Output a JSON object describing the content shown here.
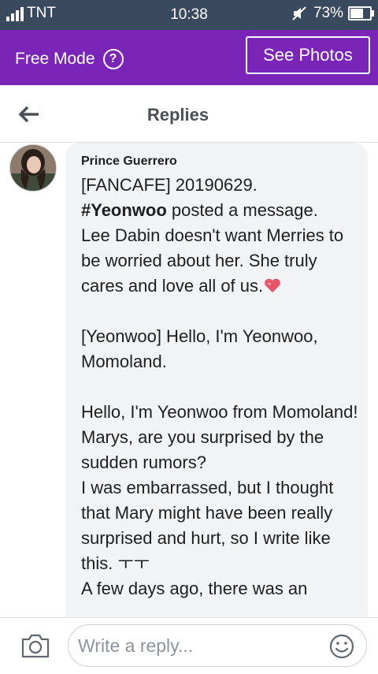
{
  "status_bar": {
    "carrier": "TNT",
    "time": "10:38",
    "battery": "73%",
    "battery_level": 0.73
  },
  "mode_bar": {
    "label": "Free Mode",
    "help_symbol": "?",
    "see_photos_label": "See Photos",
    "color": "#7b24b8"
  },
  "header": {
    "title": "Replies"
  },
  "comment": {
    "author": "Prince Guerrero",
    "lines": {
      "l1": "[FANCAFE] 20190629.",
      "hashtag": "#Yeonwoo",
      "l2_rest": " posted a message.",
      "l3": "Lee Dabin doesn't want Merries to be worried about her. She truly cares and love all of us.",
      "l4": "[Yeonwoo] Hello, I'm Yeonwoo, Momoland.",
      "l5": "Hello, I'm Yeonwoo from Momoland!",
      "l6": "Marys, are you surprised by the sudden rumors?",
      "l7": "I was embarrassed, but I thought that Mary might have been really surprised and hurt, so I write like this. ㅜㅜ",
      "l8": "A few days ago, there was an"
    }
  },
  "reply_bar": {
    "placeholder": "Write a reply..."
  },
  "icons": [
    "signal-icon",
    "mute-icon",
    "battery-icon",
    "help-icon",
    "back-arrow-icon",
    "heart-icon",
    "camera-icon",
    "emoji-icon"
  ]
}
